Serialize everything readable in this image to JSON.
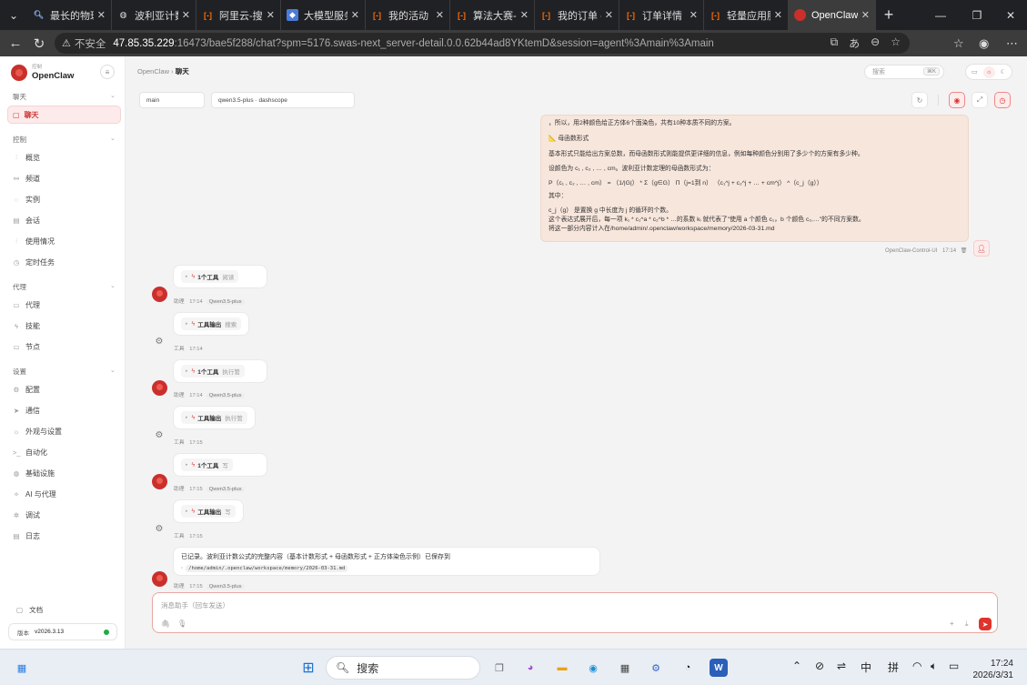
{
  "browser": {
    "tabs": [
      {
        "title": "最长的物理",
        "icon": "search-icon"
      },
      {
        "title": "波利亚计数",
        "icon": "globe-icon"
      },
      {
        "title": "阿里云-搜索",
        "icon": "aliyun-icon"
      },
      {
        "title": "大模型服务",
        "icon": "bailian-icon"
      },
      {
        "title": "我的活动",
        "icon": "aliyun-icon"
      },
      {
        "title": "算法大赛-天",
        "icon": "aliyun-icon"
      },
      {
        "title": "我的订单 -",
        "icon": "aliyun-icon"
      },
      {
        "title": "订单详情（",
        "icon": "aliyun-icon"
      },
      {
        "title": "轻量应用服",
        "icon": "aliyun-icon"
      },
      {
        "title": "OpenClaw",
        "icon": "openclaw-icon",
        "active": true
      }
    ],
    "address": {
      "warning": "不安全",
      "host": "47.85.35.229",
      "path": ":16473/bae5f288/chat?spm=5176.swas-next_server-detail.0.0.62b44ad8YKtemD&session=agent%3Amain%3Amain"
    }
  },
  "brand": {
    "sub": "控制",
    "name": "OpenClaw"
  },
  "sidebar": {
    "sections": {
      "chat": "聊天",
      "control": "控制",
      "agent": "代理",
      "settings": "设置"
    },
    "active_item": "聊天",
    "control_items": [
      "概览",
      "频道",
      "实例",
      "会话",
      "使用情况",
      "定时任务"
    ],
    "agent_items": [
      "代理",
      "技能",
      "节点"
    ],
    "settings_items": [
      "配置",
      "通信",
      "外观与设置",
      "自动化",
      "基础设施",
      "AI 与代理",
      "调试",
      "日志"
    ],
    "docs": "文档",
    "version_label": "版本",
    "version": "v2026.3.13"
  },
  "header": {
    "breadcrumb_root": "OpenClaw",
    "breadcrumb_current": "聊天",
    "search_placeholder": "搜索",
    "search_kbd": "⌘K"
  },
  "chat": {
    "session_select": "main",
    "model_select": "qwen3.5-plus · dashscope",
    "user_message": {
      "lines": [
        "，所以，用2种颜色给正方体6个面染色，共有10种本质不同的方案。",
        "📐 母函数形式",
        "基本形式只能给出方案总数，而母函数形式则能提供更详细的信息，例如每种颜色分别用了多少个的方案有多少种。",
        "设颜色为 c₁ , c₂ , … , cm。波利亚计数定理的母函数形式为：",
        "P（c₁ , c₂ , … , cm） = （1/|G|） * Σ（g∈G） Π（j=1到 n）   （c₁^j + c₂^j + … + cm^j） ^（c_j（g））",
        "其中：",
        "c_j（g） 是置换 g 中长度为 j 的循环的个数。",
        "这个表达式展开后，每一项 k₁ * c₁^a * c₂^b * …的系数 kᵢ 就代表了\"使用 a 个颜色 c₁，b 个颜色 c₂,…\"的不同方案数。",
        "将这一部分内容计入在/home/admin/.openclaw/workspace/memory/2026-03-31.md"
      ],
      "sender": "OpenClaw-Control-UI",
      "time": "17:14"
    },
    "events": [
      {
        "kind": "assistant",
        "title": "1个工具",
        "sub": "阅读",
        "who": "助理",
        "time": "17:14",
        "model": "Qwen3.5-plus"
      },
      {
        "kind": "tool",
        "title": "工具输出",
        "sub": "搜索",
        "who": "工具",
        "time": "17:14"
      },
      {
        "kind": "assistant",
        "title": "1个工具",
        "sub": "执行管",
        "who": "助理",
        "time": "17:14",
        "model": "Qwen3.5-plus"
      },
      {
        "kind": "tool",
        "title": "工具输出",
        "sub": "执行管",
        "who": "工具",
        "time": "17:15"
      },
      {
        "kind": "assistant",
        "title": "1个工具",
        "sub": "写",
        "who": "助理",
        "time": "17:15",
        "model": "Qwen3.5-plus"
      },
      {
        "kind": "tool",
        "title": "工具输出",
        "sub": "写",
        "who": "工具",
        "time": "17:15"
      }
    ],
    "final": {
      "text": "已记录。波利亚计数公式的完整内容（基本计数形式 + 母函数形式 + 正方体染色示例）已保存到",
      "path": "/home/admin/.openclaw/workspace/memory/2026-03-31.md",
      "who": "助理",
      "time": "17:15",
      "model": "Qwen3.5-plus"
    },
    "composer_placeholder": "消息助手（回车发送）"
  },
  "taskbar": {
    "search": "搜索",
    "ime_lang": "中",
    "ime_mode": "拼",
    "time": "17:24",
    "date": "2026/3/31"
  },
  "colors": {
    "accent": "#e0332b",
    "user_bubble": "#f7e6dc"
  }
}
